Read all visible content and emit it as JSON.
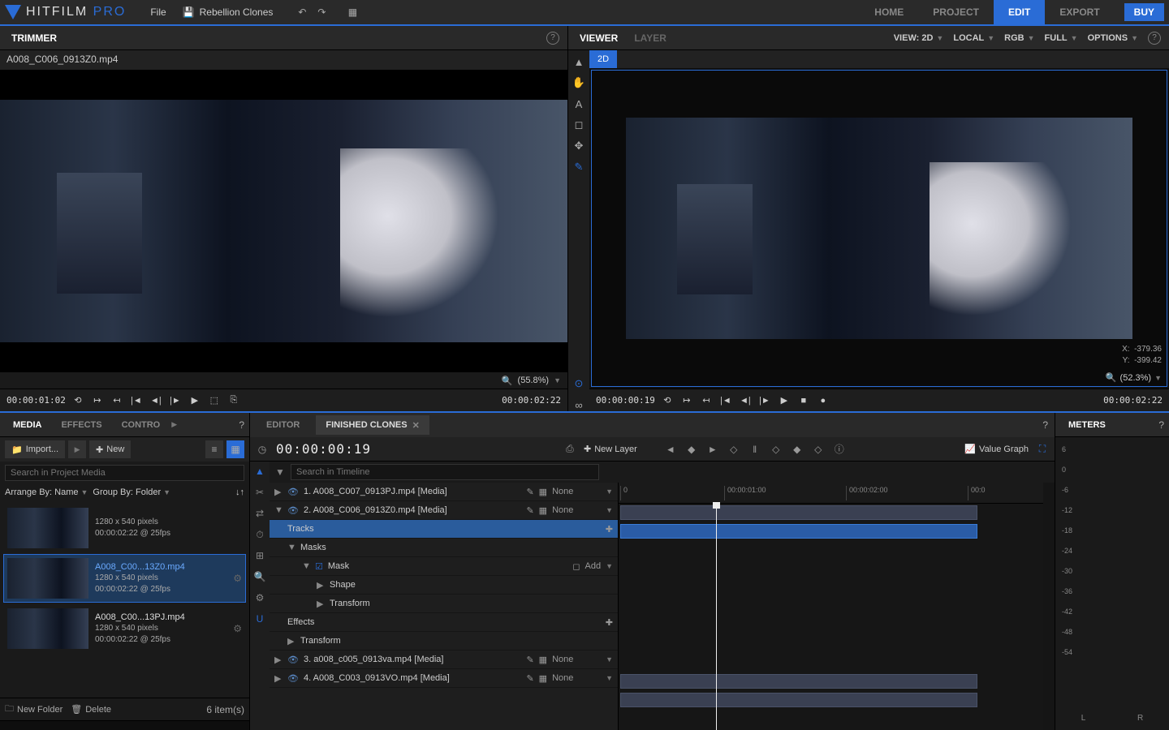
{
  "app": {
    "name_a": "HITFILM ",
    "name_b": "PRO"
  },
  "topmenu": {
    "file": "File",
    "project": "Rebellion Clones"
  },
  "toptabs": {
    "home": "HOME",
    "project": "PROJECT",
    "edit": "EDIT",
    "export": "EXPORT"
  },
  "buy": "BUY",
  "trimmer": {
    "title": "TRIMMER",
    "clip": "A008_C006_0913Z0.mp4",
    "zoom": "(55.8%)",
    "tc_left": "00:00:01:02",
    "tc_right": "00:00:02:22"
  },
  "viewer": {
    "title": "VIEWER",
    "layer": "LAYER",
    "view": "VIEW: 2D",
    "local": "LOCAL",
    "rgb": "RGB",
    "full": "FULL",
    "options": "OPTIONS",
    "tab": "2D",
    "xlabel": "X:",
    "xval": "-379.36",
    "ylabel": "Y:",
    "yval": "-399.42",
    "zoom": "(52.3%)",
    "tc_left": "00:00:00:19",
    "tc_right": "00:00:02:22"
  },
  "media": {
    "tabs": {
      "media": "MEDIA",
      "effects": "EFFECTS",
      "controls": "CONTRO"
    },
    "import": "Import...",
    "new": "New",
    "search_ph": "Search in Project Media",
    "arrange": "Arrange By: Name",
    "group": "Group By: Folder",
    "items": [
      {
        "name": "",
        "dims": "1280 x 540 pixels",
        "dur": "00:00:02:22 @ 25fps"
      },
      {
        "name": "A008_C00...13Z0.mp4",
        "dims": "1280 x 540 pixels",
        "dur": "00:00:02:22 @ 25fps"
      },
      {
        "name": "A008_C00...13PJ.mp4",
        "dims": "1280 x 540 pixels",
        "dur": "00:00:02:22 @ 25fps"
      }
    ],
    "newfolder": "New Folder",
    "delete": "Delete",
    "count": "6 item(s)"
  },
  "timeline": {
    "tabs": {
      "editor": "EDITOR",
      "finished": "FINISHED CLONES"
    },
    "tc": "00:00:00:19",
    "newlayer": "New Layer",
    "valuegraph": "Value Graph",
    "search_ph": "Search in Timeline",
    "rows": {
      "r1": "1. A008_C007_0913PJ.mp4 [Media]",
      "r2": "2. A008_C006_0913Z0.mp4 [Media]",
      "tracks": "Tracks",
      "masks": "Masks",
      "mask": "Mask",
      "add": "Add",
      "shape": "Shape",
      "transform_sub": "Transform",
      "effects": "Effects",
      "transform": "Transform",
      "r3": "3. a008_c005_0913va.mp4 [Media]",
      "r4": "4. A008_C003_0913VO.mp4 [Media]",
      "none": "None"
    },
    "ruler": {
      "t0": "0",
      "t1": "00:00:01:00",
      "t2": "00:00:02:00",
      "t3": "00:0"
    }
  },
  "meters": {
    "title": "METERS",
    "db": [
      "6",
      "0",
      "-6",
      "-12",
      "-18",
      "-24",
      "-30",
      "-36",
      "-42",
      "-48",
      "-54"
    ],
    "l": "L",
    "r": "R"
  }
}
